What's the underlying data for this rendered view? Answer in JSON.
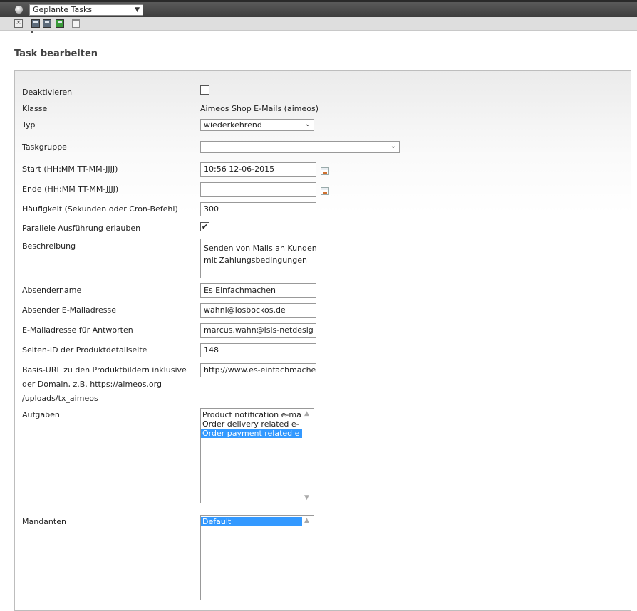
{
  "topbar": {
    "module_select": "Geplante Tasks"
  },
  "heading": "Task bearbeiten",
  "form": {
    "deaktivieren": {
      "label": "Deaktivieren",
      "checked": false
    },
    "klasse": {
      "label": "Klasse",
      "value": "Aimeos Shop E-Mails (aimeos)"
    },
    "typ": {
      "label": "Typ",
      "value": "wiederkehrend"
    },
    "taskgruppe": {
      "label": "Taskgruppe",
      "value": ""
    },
    "start": {
      "label": "Start (HH:MM TT-MM-JJJJ)",
      "value": "10:56 12-06-2015"
    },
    "ende": {
      "label": "Ende (HH:MM TT-MM-JJJJ)",
      "value": ""
    },
    "haeufigkeit": {
      "label": "Häufigkeit (Sekunden oder Cron-Befehl)",
      "value": "300"
    },
    "parallel": {
      "label": "Parallele Ausführung erlauben",
      "checked": true,
      "check_glyph": "✔"
    },
    "beschreibung": {
      "label": "Beschreibung",
      "line1": "Senden von Mails an Kunden",
      "line2": "mit Zahlungsbedingungen"
    },
    "absendername": {
      "label": "Absendername",
      "value": "Es Einfachmachen"
    },
    "absender_email": {
      "label": "Absender E-Mailadresse",
      "value": "wahni@losbockos.de"
    },
    "antwort_email": {
      "label": "E-Mailadresse für Antworten",
      "value": "marcus.wahn@isis-netdesig"
    },
    "seiten_id": {
      "label": "Seiten-ID der Produktdetailseite",
      "value": "148"
    },
    "basis_url": {
      "label_line1": "Basis-URL zu den Produktbildern inklusive",
      "label_line2": "der Domain, z.B. https://aimeos.org",
      "label_line3": "/uploads/tx_aimeos",
      "value": "http://www.es-einfachmache"
    },
    "aufgaben": {
      "label": "Aufgaben",
      "options": [
        "Product notification e-ma",
        "Order delivery related e-",
        "Order payment related e"
      ],
      "selected_index": 2
    },
    "mandanten": {
      "label": "Mandanten",
      "options": [
        "Default"
      ],
      "selected_index": 0
    }
  },
  "colors": {
    "selection": "#3399ff",
    "topbar": "#4a4a4a",
    "toolbar": "#dedede",
    "save_green": "#3a9a3a"
  }
}
